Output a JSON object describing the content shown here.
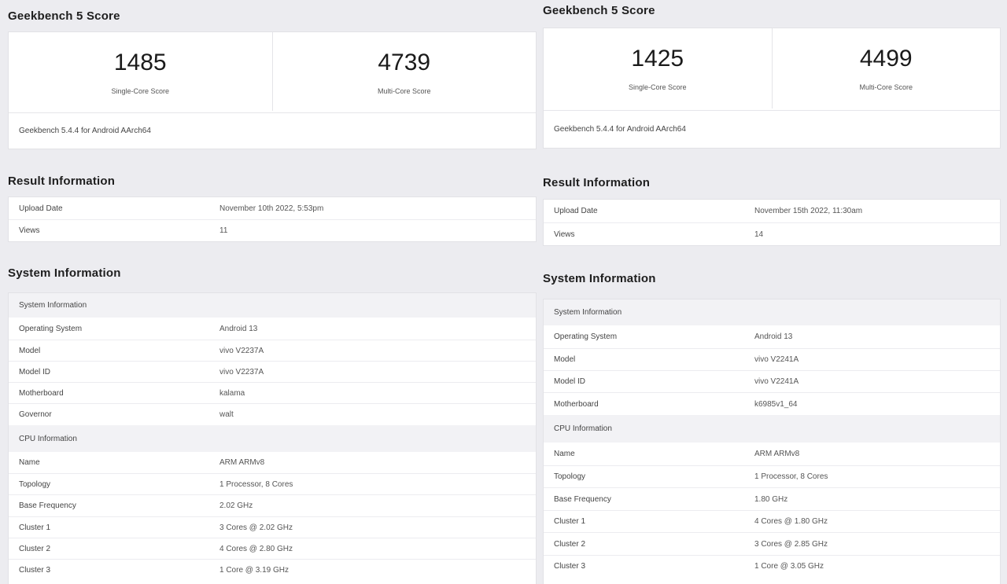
{
  "left": {
    "score_title": "Geekbench 5 Score",
    "single_core_score": "1485",
    "single_core_label": "Single-Core Score",
    "multi_core_score": "4739",
    "multi_core_label": "Multi-Core Score",
    "version": "Geekbench 5.4.4 for Android AArch64",
    "result_title": "Result Information",
    "result_rows": [
      {
        "key": "Upload Date",
        "value": "November 10th 2022, 5:53pm"
      },
      {
        "key": "Views",
        "value": "11"
      }
    ],
    "system_title": "System Information",
    "system_subhead": "System Information",
    "system_rows": [
      {
        "key": "Operating System",
        "value": "Android 13"
      },
      {
        "key": "Model",
        "value": "vivo V2237A"
      },
      {
        "key": "Model ID",
        "value": "vivo V2237A"
      },
      {
        "key": "Motherboard",
        "value": "kalama"
      },
      {
        "key": "Governor",
        "value": "walt"
      }
    ],
    "cpu_subhead": "CPU Information",
    "cpu_rows": [
      {
        "key": "Name",
        "value": "ARM ARMv8"
      },
      {
        "key": "Topology",
        "value": "1 Processor, 8 Cores"
      },
      {
        "key": "Base Frequency",
        "value": "2.02 GHz"
      },
      {
        "key": "Cluster 1",
        "value": "3 Cores @ 2.02 GHz"
      },
      {
        "key": "Cluster 2",
        "value": "4 Cores @ 2.80 GHz"
      },
      {
        "key": "Cluster 3",
        "value": "1 Core @ 3.19 GHz"
      }
    ]
  },
  "right": {
    "score_title": "Geekbench 5 Score",
    "single_core_score": "1425",
    "single_core_label": "Single-Core Score",
    "multi_core_score": "4499",
    "multi_core_label": "Multi-Core Score",
    "version": "Geekbench 5.4.4 for Android AArch64",
    "result_title": "Result Information",
    "result_rows": [
      {
        "key": "Upload Date",
        "value": "November 15th 2022, 11:30am"
      },
      {
        "key": "Views",
        "value": "14"
      }
    ],
    "system_title": "System Information",
    "system_subhead": "System Information",
    "system_rows": [
      {
        "key": "Operating System",
        "value": "Android 13"
      },
      {
        "key": "Model",
        "value": "vivo V2241A"
      },
      {
        "key": "Model ID",
        "value": "vivo V2241A"
      },
      {
        "key": "Motherboard",
        "value": "k6985v1_64"
      }
    ],
    "cpu_subhead": "CPU Information",
    "cpu_rows": [
      {
        "key": "Name",
        "value": "ARM ARMv8"
      },
      {
        "key": "Topology",
        "value": "1 Processor, 8 Cores"
      },
      {
        "key": "Base Frequency",
        "value": "1.80 GHz"
      },
      {
        "key": "Cluster 1",
        "value": "4 Cores @ 1.80 GHz"
      },
      {
        "key": "Cluster 2",
        "value": "3 Cores @ 2.85 GHz"
      },
      {
        "key": "Cluster 3",
        "value": "1 Core @ 3.05 GHz"
      }
    ]
  }
}
